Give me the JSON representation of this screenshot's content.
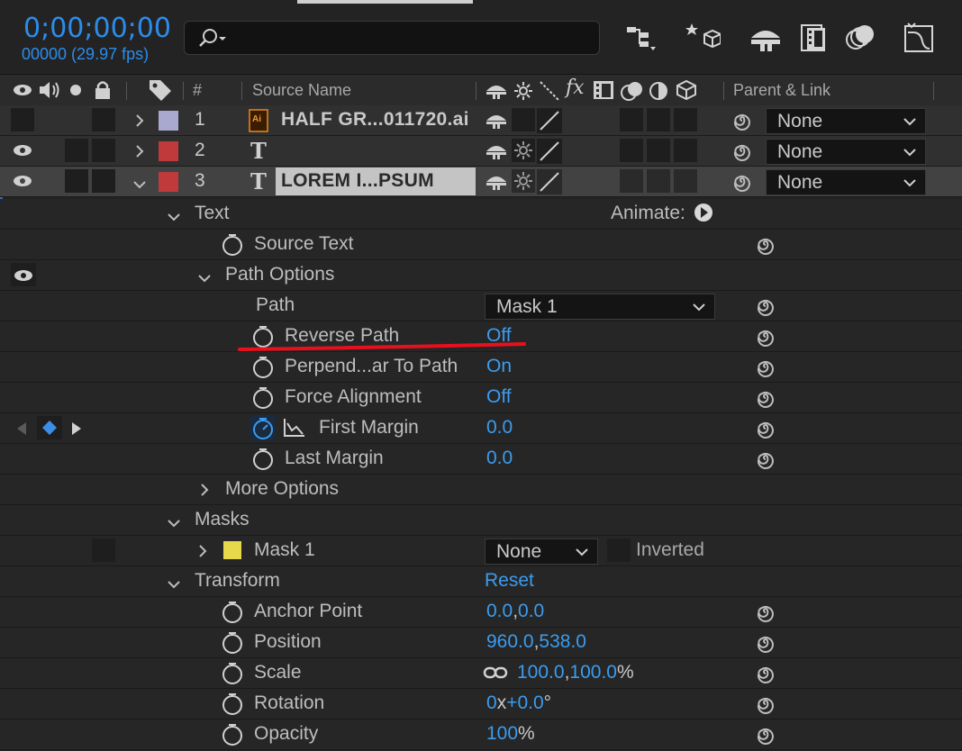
{
  "header": {
    "timecode": "0;00;00;00",
    "frames": "00000 (29.97 fps)",
    "search_placeholder": ""
  },
  "columns": {
    "number": "#",
    "source_name": "Source Name",
    "parent_link": "Parent & Link",
    "fx": "fx"
  },
  "layers": [
    {
      "num": "1",
      "name": "HALF GR...011720.ai",
      "type": "ai",
      "icon_label": "Ai",
      "color": "#a9a9d0",
      "parent": "None",
      "visible": false,
      "expanded": false
    },
    {
      "num": "2",
      "name": "T",
      "type": "text",
      "label": "",
      "color": "#c0393b",
      "parent": "None",
      "visible": true,
      "expanded": false
    },
    {
      "num": "3",
      "name": "LOREM I...PSUM",
      "type": "text",
      "color": "#c0393b",
      "parent": "None",
      "visible": true,
      "expanded": true
    }
  ],
  "text_icon_glyph": "T",
  "props": {
    "text": "Text",
    "animate": "Animate:",
    "source_text": "Source Text",
    "path_options": "Path Options",
    "path": "Path",
    "path_value": "Mask 1",
    "reverse_path": "Reverse Path",
    "reverse_path_value": "Off",
    "perpendicular": "Perpend...ar To Path",
    "perpendicular_value": "On",
    "force_alignment": "Force Alignment",
    "force_alignment_value": "Off",
    "first_margin": "First Margin",
    "first_margin_value": "0.0",
    "last_margin": "Last Margin",
    "last_margin_value": "0.0",
    "more_options": "More Options",
    "masks": "Masks",
    "mask1": "Mask 1",
    "mask1_mode": "None",
    "inverted": "Inverted",
    "transform": "Transform",
    "reset": "Reset",
    "anchor_point": "Anchor Point",
    "anchor_x": "0.0",
    "anchor_comma": ",",
    "anchor_y": "0.0",
    "position": "Position",
    "position_x": "960.0",
    "position_comma": ",",
    "position_y": "538.0",
    "scale": "Scale",
    "scale_x": "100.0",
    "scale_comma": ",",
    "scale_y": "100.0",
    "scale_unit": "%",
    "rotation": "Rotation",
    "rotation_turns": "0",
    "rotation_x": "x",
    "rotation_deg": "+0.0",
    "rotation_unit": "°",
    "opacity": "Opacity",
    "opacity_value": "100",
    "opacity_unit": "%"
  },
  "colors": {
    "accent_blue": "#3b9cf0",
    "annotation_red": "#e8101c",
    "mask_swatch": "#e6d84a"
  }
}
